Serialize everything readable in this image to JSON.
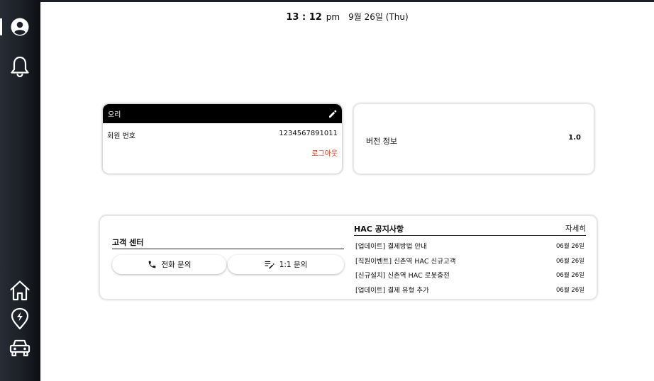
{
  "header": {
    "time": "13 : 12",
    "ampm": "pm",
    "date": "9월 26일 (Thu)"
  },
  "sidebar": {
    "items": [
      {
        "icon": "profile-icon"
      },
      {
        "icon": "bell-icon"
      },
      {
        "icon": "home-icon"
      },
      {
        "icon": "charging-pin-icon"
      },
      {
        "icon": "car-icon"
      }
    ]
  },
  "user_card": {
    "name": "오리",
    "member_label": "회원 번호",
    "member_number": "1234567891011",
    "logout_label": "로그아웃",
    "edit_icon": "pencil-icon"
  },
  "version_card": {
    "label": "버전 정보",
    "value": "1.0"
  },
  "customer_center": {
    "title": "고객 센터",
    "phone_label": "전화 문의",
    "qna_label": "1:1 문의"
  },
  "notices": {
    "title": "HAC 공지사항",
    "more_label": "자세히",
    "items": [
      {
        "text": "[업데이트] 결제방법 안내",
        "date": "06월 26일"
      },
      {
        "text": "[직원이벤트] 신촌역 HAC 신규고객",
        "date": "06월 26일"
      },
      {
        "text": "[신규설치] 신촌역 HAC 로봇충전",
        "date": "06월 26일"
      },
      {
        "text": "[업데이트] 결제 유형 추가",
        "date": "06월 26일"
      }
    ]
  },
  "colors": {
    "sidebar_bg": "#1b1f26",
    "logout": "#e53b1e",
    "card_header": "#000000"
  }
}
